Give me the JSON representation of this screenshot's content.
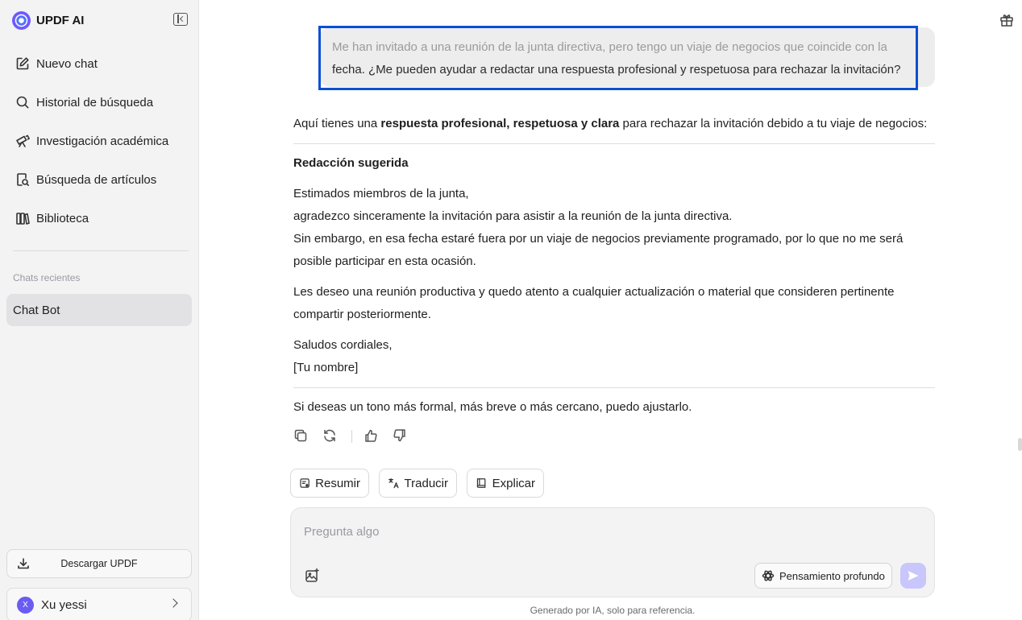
{
  "app": {
    "name": "UPDF AI"
  },
  "sidebar": {
    "nav": [
      {
        "label": "Nuevo chat",
        "icon": "edit-icon"
      },
      {
        "label": "Historial de búsqueda",
        "icon": "search-icon"
      },
      {
        "label": "Investigación académica",
        "icon": "telescope-icon"
      },
      {
        "label": "Búsqueda de artículos",
        "icon": "document-search-icon"
      },
      {
        "label": "Biblioteca",
        "icon": "library-icon"
      }
    ],
    "recent_label": "Chats recientes",
    "recent_chats": [
      {
        "label": "Chat Bot"
      }
    ],
    "download_label": "Descargar UPDF",
    "user": {
      "initial": "X",
      "name": "Xu yessi"
    }
  },
  "chat": {
    "user_message": {
      "line1": "Me han invitado a una reunión de la junta directiva, pero tengo un viaje de negocios que coincide con la",
      "line2": "fecha. ¿Me pueden ayudar a redactar una respuesta profesional y respetuosa para rechazar la invitación?"
    },
    "answer": {
      "intro_before": "Aquí tienes una ",
      "intro_bold": "respuesta profesional, respetuosa y clara",
      "intro_after": " para rechazar la invitación debido a tu viaje de negocios:",
      "heading": "Redacción sugerida",
      "p1": [
        "Estimados miembros de la junta,",
        "agradezco sinceramente la invitación para asistir a la reunión de la junta directiva.",
        "Sin embargo, en esa fecha estaré fuera por un viaje de negocios previamente programado, por lo que no me será",
        "posible participar en esta ocasión."
      ],
      "p2": [
        "Les deseo una reunión productiva y quedo atento a cualquier actualización o material que consideren pertinente",
        "compartir posteriormente."
      ],
      "p3": [
        "Saludos cordiales,",
        "[Tu nombre]"
      ],
      "closing": "Si deseas un tono más formal, más breve o más cercano, puedo ajustarlo."
    },
    "quick_actions": [
      {
        "label": "Resumir",
        "icon": "summarize-icon"
      },
      {
        "label": "Traducir",
        "icon": "translate-icon"
      },
      {
        "label": "Explicar",
        "icon": "book-icon"
      }
    ],
    "input": {
      "placeholder": "Pregunta algo",
      "deep_thinking_label": "Pensamiento profundo"
    },
    "footer_note": "Generado por IA, solo para referencia."
  },
  "colors": {
    "highlight_border": "#0a4fd4",
    "send_button": "#c9c6fb",
    "sidebar_bg": "#f3f3f4"
  }
}
